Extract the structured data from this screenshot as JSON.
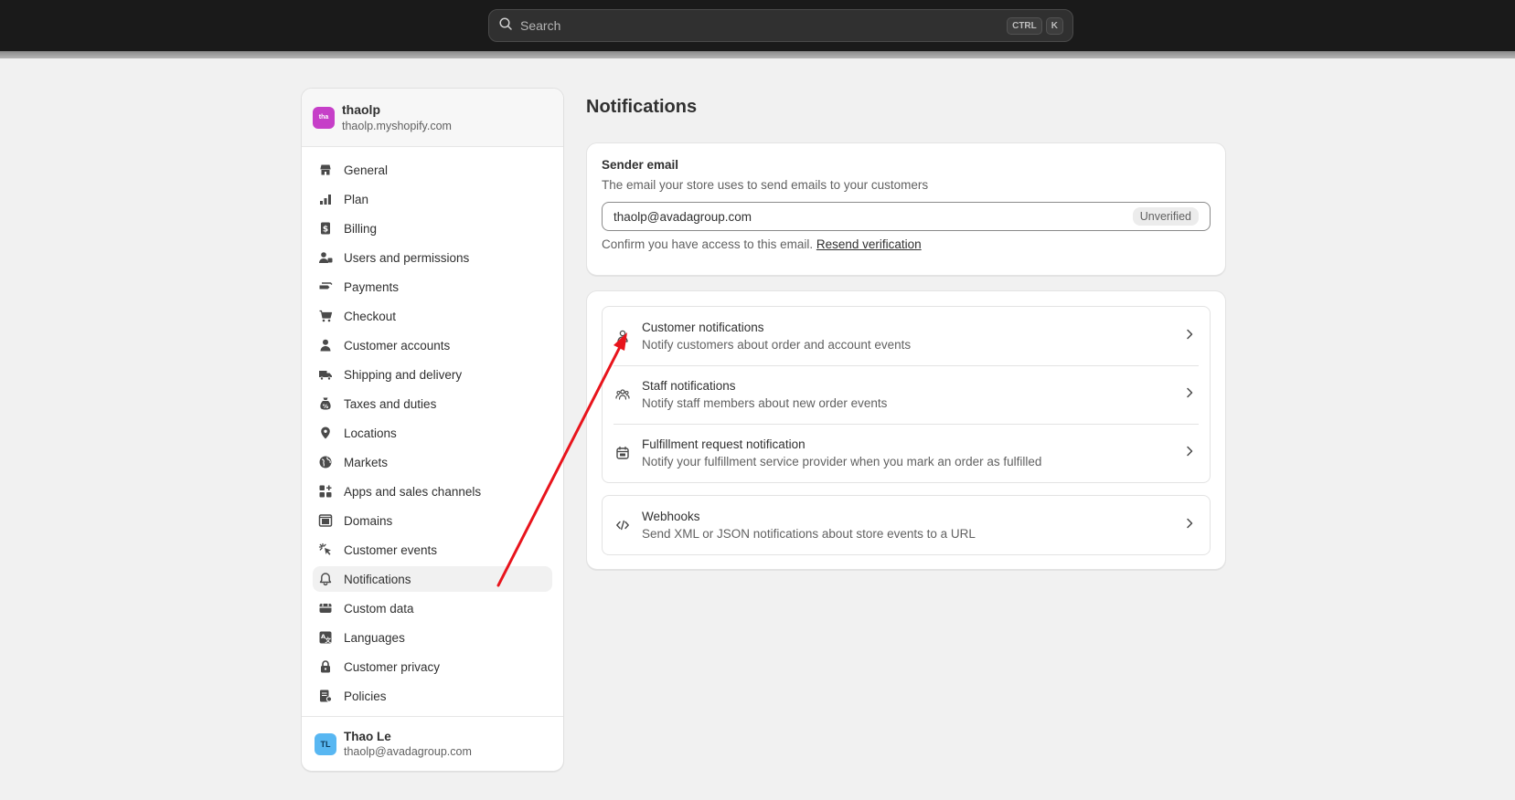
{
  "topbar": {
    "search_placeholder": "Search",
    "shortcut_key1": "CTRL",
    "shortcut_key2": "K"
  },
  "store": {
    "logo_text": "tha",
    "name": "thaolp",
    "domain": "thaolp.myshopify.com",
    "logo_color": "#c63fc8"
  },
  "sidebar": {
    "items": [
      {
        "label": "General",
        "icon": "store-icon"
      },
      {
        "label": "Plan",
        "icon": "plan-icon"
      },
      {
        "label": "Billing",
        "icon": "billing-icon"
      },
      {
        "label": "Users and permissions",
        "icon": "users-icon"
      },
      {
        "label": "Payments",
        "icon": "payments-icon"
      },
      {
        "label": "Checkout",
        "icon": "cart-icon"
      },
      {
        "label": "Customer accounts",
        "icon": "person-icon"
      },
      {
        "label": "Shipping and delivery",
        "icon": "truck-icon"
      },
      {
        "label": "Taxes and duties",
        "icon": "tax-icon"
      },
      {
        "label": "Locations",
        "icon": "location-icon"
      },
      {
        "label": "Markets",
        "icon": "globe-icon"
      },
      {
        "label": "Apps and sales channels",
        "icon": "apps-icon"
      },
      {
        "label": "Domains",
        "icon": "domains-icon"
      },
      {
        "label": "Customer events",
        "icon": "cursor-click-icon"
      },
      {
        "label": "Notifications",
        "icon": "bell-icon",
        "active": true
      },
      {
        "label": "Custom data",
        "icon": "custom-data-icon"
      },
      {
        "label": "Languages",
        "icon": "language-icon"
      },
      {
        "label": "Customer privacy",
        "icon": "lock-icon"
      },
      {
        "label": "Policies",
        "icon": "policies-icon"
      }
    ]
  },
  "user": {
    "initials": "TL",
    "name": "Thao Le",
    "email": "thaolp@avadagroup.com",
    "avatar_color": "#58b7f2"
  },
  "main": {
    "title": "Notifications",
    "sender": {
      "title": "Sender email",
      "description": "The email your store uses to send emails to your customers",
      "email": "thaolp@avadagroup.com",
      "status": "Unverified",
      "confirm_text": "Confirm you have access to this email.",
      "resend_link": "Resend verification"
    },
    "notification_rows": [
      {
        "title": "Customer notifications",
        "description": "Notify customers about order and account events",
        "icon": "person-icon"
      },
      {
        "title": "Staff notifications",
        "description": "Notify staff members about new order events",
        "icon": "team-icon"
      },
      {
        "title": "Fulfillment request notification",
        "description": "Notify your fulfillment service provider when you mark an order as fulfilled",
        "icon": "calendar-box-icon"
      }
    ],
    "webhooks": {
      "title": "Webhooks",
      "description": "Send XML or JSON notifications about store events to a URL",
      "icon": "code-icon"
    }
  },
  "annotation": {
    "arrow_color": "#e8141c"
  }
}
